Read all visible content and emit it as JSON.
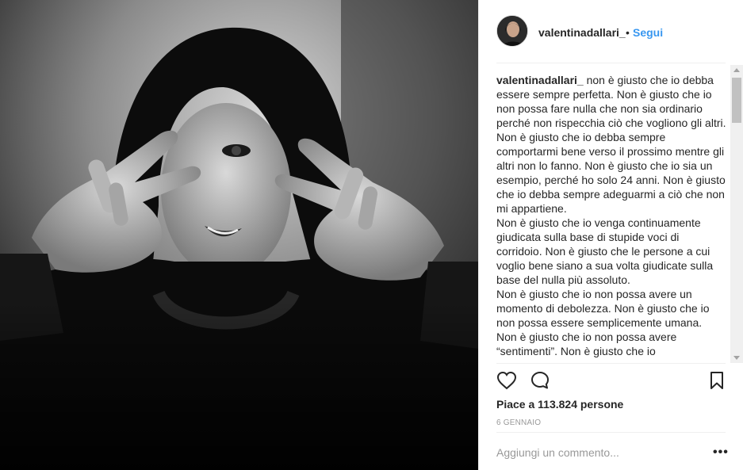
{
  "post": {
    "photo_alt": "Black and white photo",
    "username": "valentinadallari_",
    "dot": "•",
    "follow_label": "Segui",
    "caption_username": "valentinadallari_",
    "caption_lines": [
      "non è giusto che io debba essere sempre perfetta. Non è giusto che io non possa fare nulla che non sia ordinario perché non rispecchia ciò che vogliono gli altri.",
      "Non è giusto che io debba sempre comportarmi bene verso il prossimo mentre gli altri non lo fanno. Non è giusto che io sia un esempio, perché ho solo 24 anni. Non è giusto che io debba sempre adeguarmi a ciò che non mi appartiene.",
      "Non è giusto che io venga continuamente giudicata sulla base di stupide voci di corridoio. Non è giusto che le persone a cui voglio bene siano a sua volta giudicate sulla base del nulla più assoluto.",
      "Non è giusto che io non possa avere un momento di debolezza. Non è giusto che io non possa essere semplicemente umana.",
      "Non è giusto che io non possa avere “sentimenti”. Non è giusto che io"
    ],
    "likes_text": "Piace a 113.824 persone",
    "date": "6 GENNAIO",
    "comment_placeholder": "Aggiungi un commento...",
    "more_label": "•••"
  },
  "icons": {
    "like": "heart-icon",
    "comment": "comment-icon",
    "save": "bookmark-icon",
    "more": "more-options-icon"
  },
  "colors": {
    "follow": "#3897f0",
    "text": "#262626",
    "muted": "#999999",
    "divider": "#efefef"
  }
}
